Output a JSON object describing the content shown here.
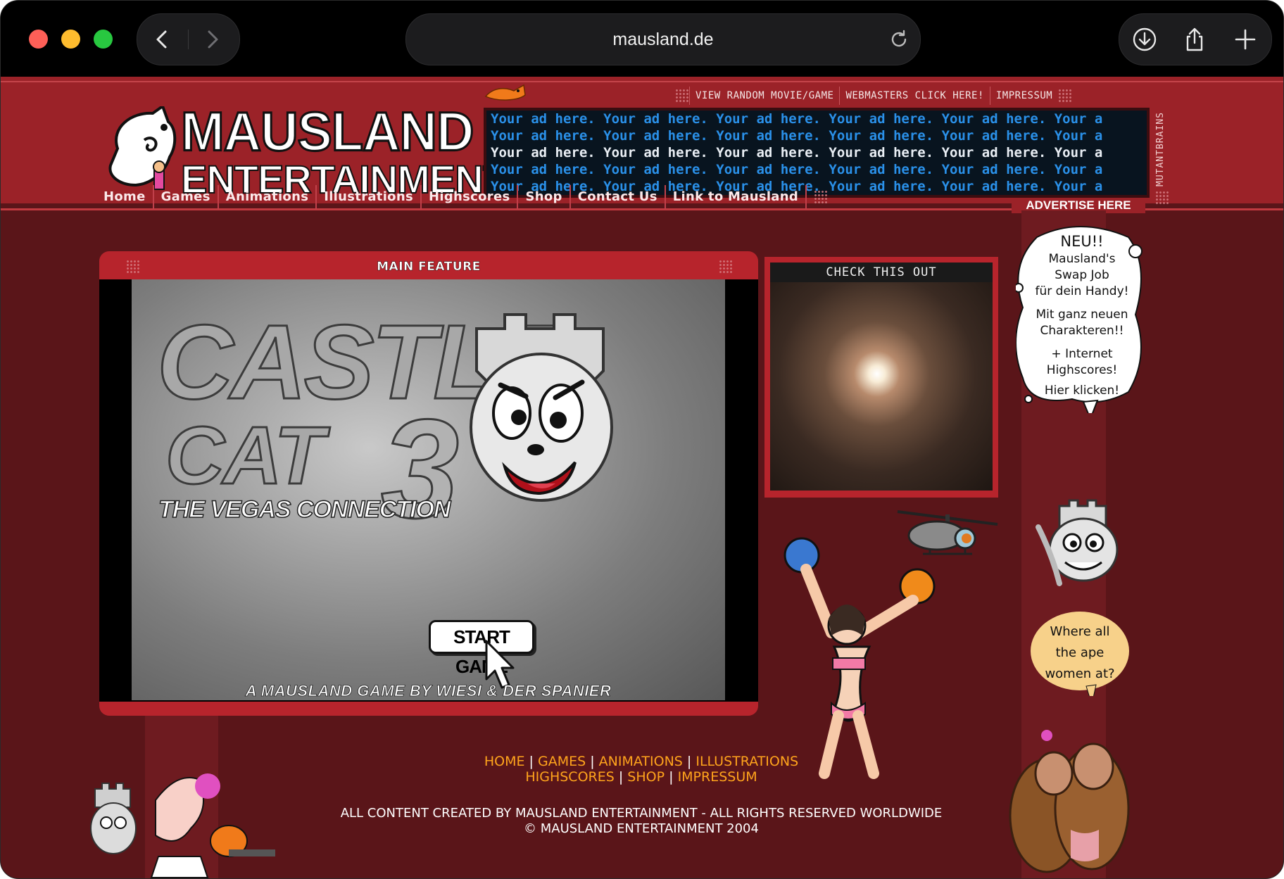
{
  "browser": {
    "url": "mausland.de"
  },
  "site": {
    "logo_line1": "MAUSLAND",
    "logo_line2": "ENTERTAINMENT",
    "top_links": [
      "VIEW RANDOM MOVIE/GAME",
      "WEBMASTERS CLICK HERE!",
      "IMPRESSUM"
    ],
    "ad_text": "Your ad here. Your ad here. Your ad here. Your ad here. Your ad here. Your a",
    "advertise_label": "ADVERTISE HERE",
    "side_label": "MUTANTBRAINS",
    "nav": [
      "Home",
      "Games",
      "Animations",
      "Illustrations",
      "Highscores",
      "Shop",
      "Contact Us",
      "Link to Mausland"
    ]
  },
  "main_feature": {
    "title": "MAIN FEATURE",
    "game_title_line1": "CASTLE",
    "game_title_line2": "CAT",
    "game_title_number": "3",
    "game_subtitle": "THE VEGAS CONNECTION",
    "start_button": "START GAME",
    "credit": "A MAUSLAND GAME BY WIESI & DER SPANIER"
  },
  "check_this_out": {
    "title": "CHECK THIS OUT"
  },
  "bubble": {
    "line1": "NEU!!",
    "line2": "Mausland's",
    "line3": "Swap Job",
    "line4": "für dein Handy!",
    "line5": "Mit ganz neuen",
    "line6": "Charakteren!!",
    "line7": "+ Internet",
    "line8": "Highscores!",
    "line9": "Hier klicken!"
  },
  "bubble2": {
    "line1": "Where all",
    "line2": "the ape",
    "line3": "women at?"
  },
  "footer": {
    "links_row1": [
      "HOME",
      "GAMES",
      "ANIMATIONS",
      "ILLUSTRATIONS"
    ],
    "links_row2": [
      "HIGHSCORES",
      "SHOP",
      "IMPRESSUM"
    ],
    "separator": "|",
    "copyright1": "ALL CONTENT CREATED BY MAUSLAND ENTERTAINMENT - ALL RIGHTS RESERVED WORLDWIDE",
    "copyright2": "© MAUSLAND ENTERTAINMENT 2004"
  }
}
